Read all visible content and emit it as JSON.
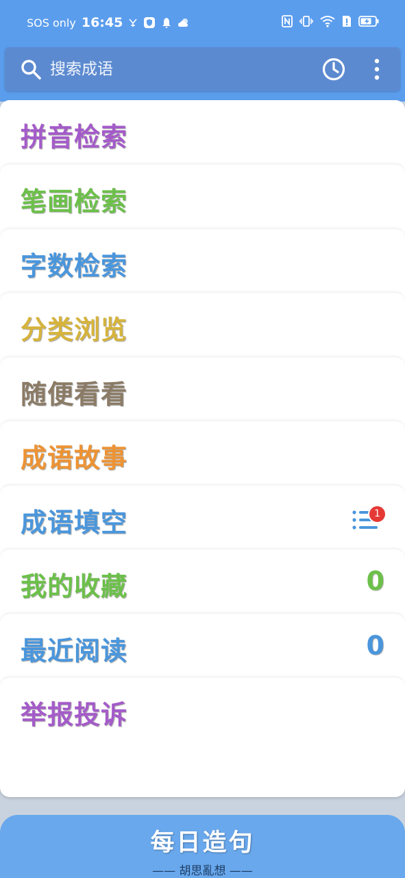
{
  "status": {
    "carrier": "SOS only",
    "time": "16:45"
  },
  "search": {
    "placeholder": "搜索成语"
  },
  "menu": [
    {
      "label": "拼音检索",
      "color": "#a45bc9"
    },
    {
      "label": "笔画检索",
      "color": "#6cc04a"
    },
    {
      "label": "字数检索",
      "color": "#4a96dc"
    },
    {
      "label": "分类浏览",
      "color": "#d6b43c"
    },
    {
      "label": "随便看看",
      "color": "#8b7b66"
    },
    {
      "label": "成语故事",
      "color": "#ed9334"
    },
    {
      "label": "成语填空",
      "color": "#4a96dc",
      "badge": "1"
    },
    {
      "label": "我的收藏",
      "color": "#6cc04a",
      "count": "0"
    },
    {
      "label": "最近阅读",
      "color": "#4a96dc",
      "count": "0"
    },
    {
      "label": "举报投诉",
      "color": "#a45bc9"
    }
  ],
  "daily": {
    "title": "每日造句",
    "subtitle": "—— 胡思亂想 ——"
  },
  "icons": {
    "search": "search-icon",
    "history": "clock-icon",
    "more": "more-vertical-icon",
    "list": "list-icon"
  }
}
